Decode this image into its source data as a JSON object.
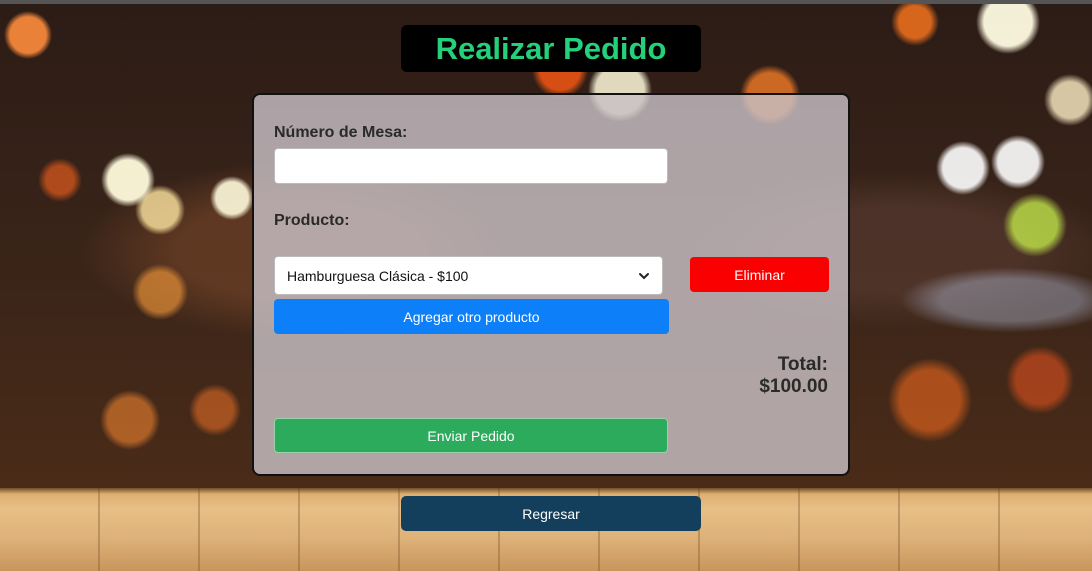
{
  "page": {
    "title": "Realizar Pedido"
  },
  "form": {
    "table_label": "Número de Mesa:",
    "table_value": "",
    "product_label": "Producto:",
    "product_selected": "Hamburguesa Clásica - $100",
    "delete_label": "Eliminar",
    "add_label": "Agregar otro producto",
    "total_text": "Total: $100.00",
    "submit_label": "Enviar Pedido"
  },
  "footer": {
    "back_label": "Regresar"
  },
  "colors": {
    "title_text": "#25d07a",
    "delete_button": "#fb0000",
    "add_button": "#0d7ff9",
    "submit_button": "#2bab5b",
    "back_button": "#143f5c"
  },
  "icons": {
    "select_arrow": "chevron-down-icon"
  }
}
